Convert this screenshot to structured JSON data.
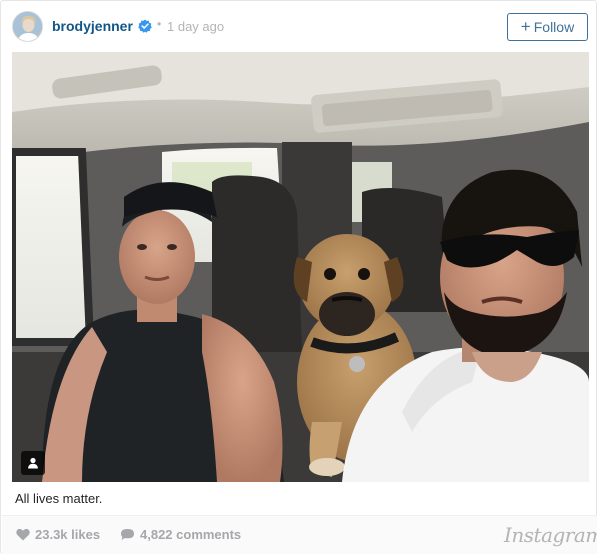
{
  "post": {
    "username": "brodyjenner",
    "dot": "•",
    "time": "1 day ago",
    "follow_label": "Follow",
    "follow_plus": "+",
    "caption": "All lives matter.",
    "likes": "23.3k likes",
    "comments": "4,822 comments",
    "brand": "Instagram"
  },
  "icons": {
    "verified": "verified-badge-icon",
    "heart": "heart-icon",
    "comment": "comment-bubble-icon",
    "user_tag": "user-tag-icon"
  },
  "colors": {
    "username": "#125688",
    "follow": "#3f729b",
    "verified": "#3897f0",
    "muted": "#a5a7aa"
  }
}
